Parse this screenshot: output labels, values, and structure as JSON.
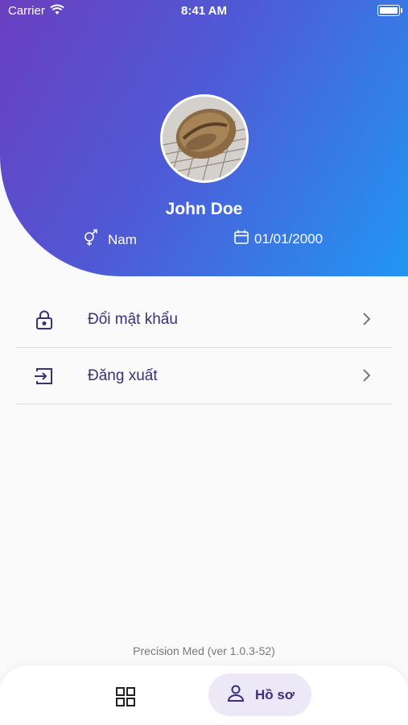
{
  "status": {
    "carrier": "Carrier",
    "time": "8:41 AM"
  },
  "profile": {
    "name": "John Doe",
    "gender": "Nam",
    "dob": "01/01/2000"
  },
  "menu": [
    {
      "label": "Đổi mật khẩu",
      "icon": "lock-icon"
    },
    {
      "label": "Đăng xuất",
      "icon": "logout-icon"
    }
  ],
  "footer": {
    "version": "Precision Med (ver 1.0.3-52)"
  },
  "bottom_nav": {
    "profile_label": "Hồ sơ",
    "home_icon": "grid-icon",
    "profile_icon": "user-icon"
  },
  "colors": {
    "gradient_start": "#6a3fc0",
    "gradient_end": "#2196f3",
    "accent": "#3a2f7a",
    "active_pill": "#ece8f8"
  }
}
